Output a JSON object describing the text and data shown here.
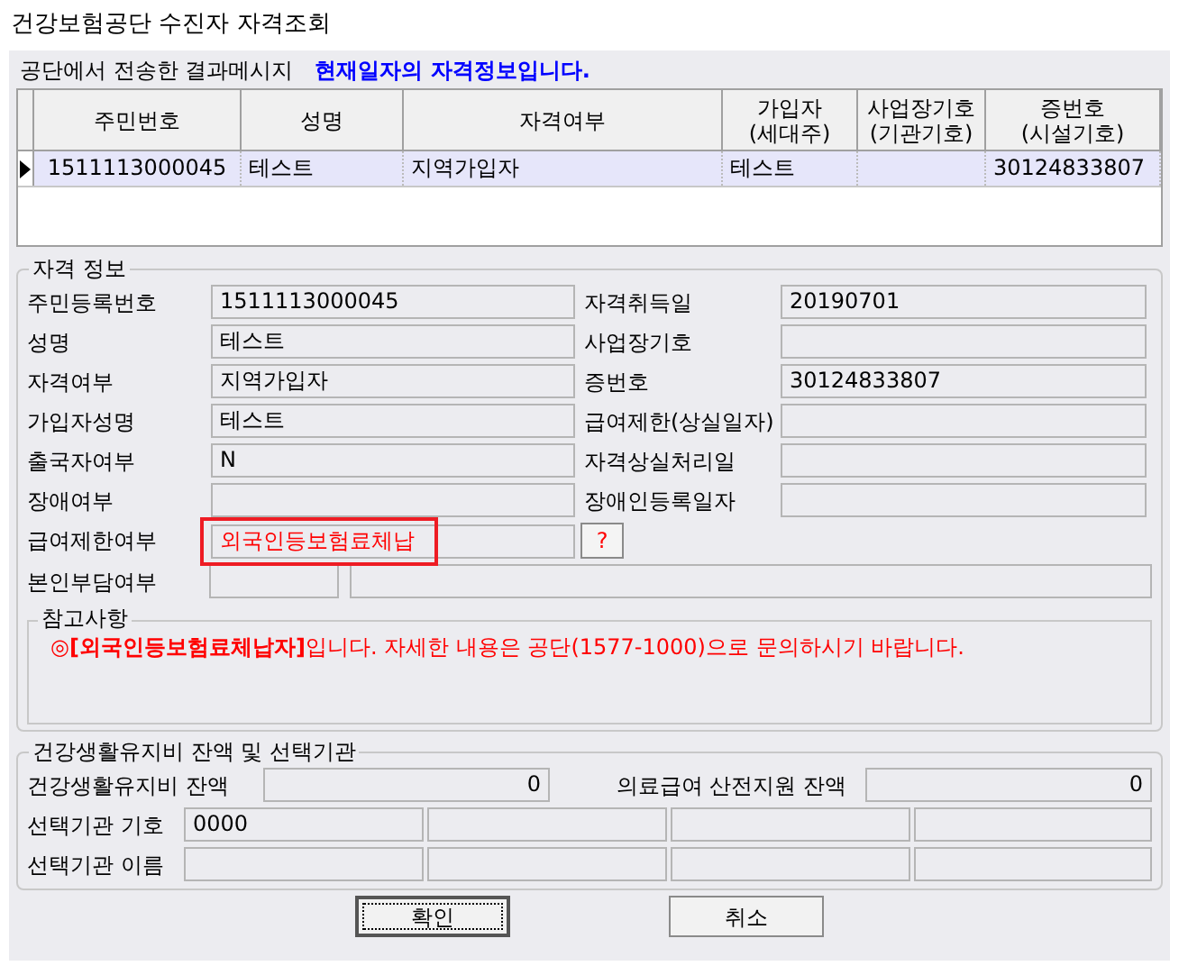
{
  "window": {
    "title": "건강보험공단 수진자 자격조회"
  },
  "result_message": {
    "label": "공단에서 전송한 결과메시지",
    "message": "현재일자의 자격정보입니다."
  },
  "table": {
    "columns": [
      "주민번호",
      "성명",
      "자격여부",
      "가입자\n(세대주)",
      "사업장기호\n(기관기호)",
      "증번호\n(시설기호)"
    ],
    "rows": [
      {
        "selected": true,
        "cells": [
          "1511113000045",
          "테스트",
          "지역가입자",
          "테스트",
          null,
          "30124833807"
        ]
      }
    ]
  },
  "qualification": {
    "title": "자격 정보",
    "rows": [
      {
        "left": {
          "label": "주민등록번호",
          "value": "1511113000045"
        },
        "right": {
          "label": "자격취득일",
          "value": "20190701"
        }
      },
      {
        "left": {
          "label": "성명",
          "value": "테스트"
        },
        "right": {
          "label": "사업장기호"
        }
      },
      {
        "left": {
          "label": "자격여부",
          "value": "지역가입자"
        },
        "right": {
          "label": "증번호",
          "value": "30124833807"
        }
      },
      {
        "left": {
          "label": "가입자성명",
          "value": "테스트"
        },
        "right": {
          "label": "급여제한(상실일자)"
        }
      },
      {
        "left": {
          "label": "출국자여부",
          "value": "N"
        },
        "right": {
          "label": "자격상실처리일"
        }
      },
      {
        "left": {
          "label": "장애여부"
        },
        "right": {
          "label": "장애인등록일자"
        }
      }
    ],
    "benefit_limit": {
      "label": "급여제한여부",
      "value": "외국인등보험료체납",
      "highlighted": true,
      "help_button": "?"
    },
    "copay": {
      "label": "본인부담여부"
    }
  },
  "notes": {
    "title": "참고사항",
    "text": "**◎[외국인등보험료체납자]**입니다. 자세한 내용은 공단(1577-1000)으로 문의하시기 바랍니다."
  },
  "balance": {
    "title": "건강생활유지비 잔액 및 선택기관",
    "health_balance": {
      "label": "건강생활유지비 잔액",
      "value": "0"
    },
    "medical_balance": {
      "label": "의료급여 산전지원 잔액",
      "value": "0"
    },
    "institution_code": {
      "label": "선택기관 기호",
      "values": [
        "0000"
      ]
    },
    "institution_name": {
      "label": "선택기관 이름"
    }
  },
  "buttons": [
    {
      "label": "확인",
      "focused": true
    },
    {
      "label": "취소",
      "focused": false
    }
  ]
}
